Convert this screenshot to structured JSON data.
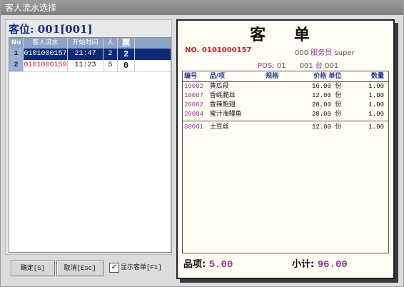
{
  "window": {
    "title": "客人流水选择"
  },
  "seat": {
    "label": "客位: 001[001]"
  },
  "grid": {
    "headers": [
      "No",
      "客人流水",
      "开始时间",
      "人",
      "票"
    ],
    "rows": [
      {
        "no": "1",
        "serial": "0101000157",
        "time": "21:47",
        "people": "2",
        "ticket": "2",
        "selected": true
      },
      {
        "no": "2",
        "serial": "0101000159",
        "time": "11:23",
        "people": "5",
        "ticket": "0",
        "selected": false
      }
    ]
  },
  "buttons": {
    "ok": "确定[S]",
    "cancel": "取消[Esc]",
    "show_bill_label": "显示客单[F1]",
    "show_bill_checked": "✓"
  },
  "receipt": {
    "title": "客 单",
    "no_label": "NO.",
    "no_value": "0101000157",
    "waiter_code": "000",
    "waiter_label": "服务员",
    "waiter_name": "super",
    "pos_label": "POS:",
    "pos_value": "01",
    "table_no": "001",
    "table_label": "台",
    "table_no2": "001",
    "columns": [
      "编号",
      "品/项",
      "规格",
      "价格",
      "单位",
      "数量"
    ],
    "items": [
      {
        "code": "10002",
        "name": "黄瓜段",
        "spec": "",
        "price": "16.00",
        "unit": "份",
        "qty": "1.00"
      },
      {
        "code": "10007",
        "name": "香蚝脆丝",
        "spec": "",
        "price": "12.00",
        "unit": "份",
        "qty": "1.00"
      },
      {
        "code": "20002",
        "name": "香辣鲍翅",
        "spec": "",
        "price": "28.00",
        "unit": "份",
        "qty": "1.00"
      },
      {
        "code": "20004",
        "name": "蜜汁海鳗鱼",
        "spec": "",
        "price": "28.00",
        "unit": "份",
        "qty": "1.00"
      },
      {
        "code": "30001",
        "name": "土豆丝",
        "spec": "",
        "price": "12.00",
        "unit": "份",
        "qty": "1.00"
      }
    ],
    "count_label": "品项:",
    "count_value": "5.00",
    "subtotal_label": "小计:",
    "subtotal_value": "96.00"
  },
  "colors": {
    "selected_row": "#0c2a78",
    "grid_header": "#8aa3c7",
    "accent_purple": "#8a3a8a",
    "accent_red": "#c8202c"
  }
}
